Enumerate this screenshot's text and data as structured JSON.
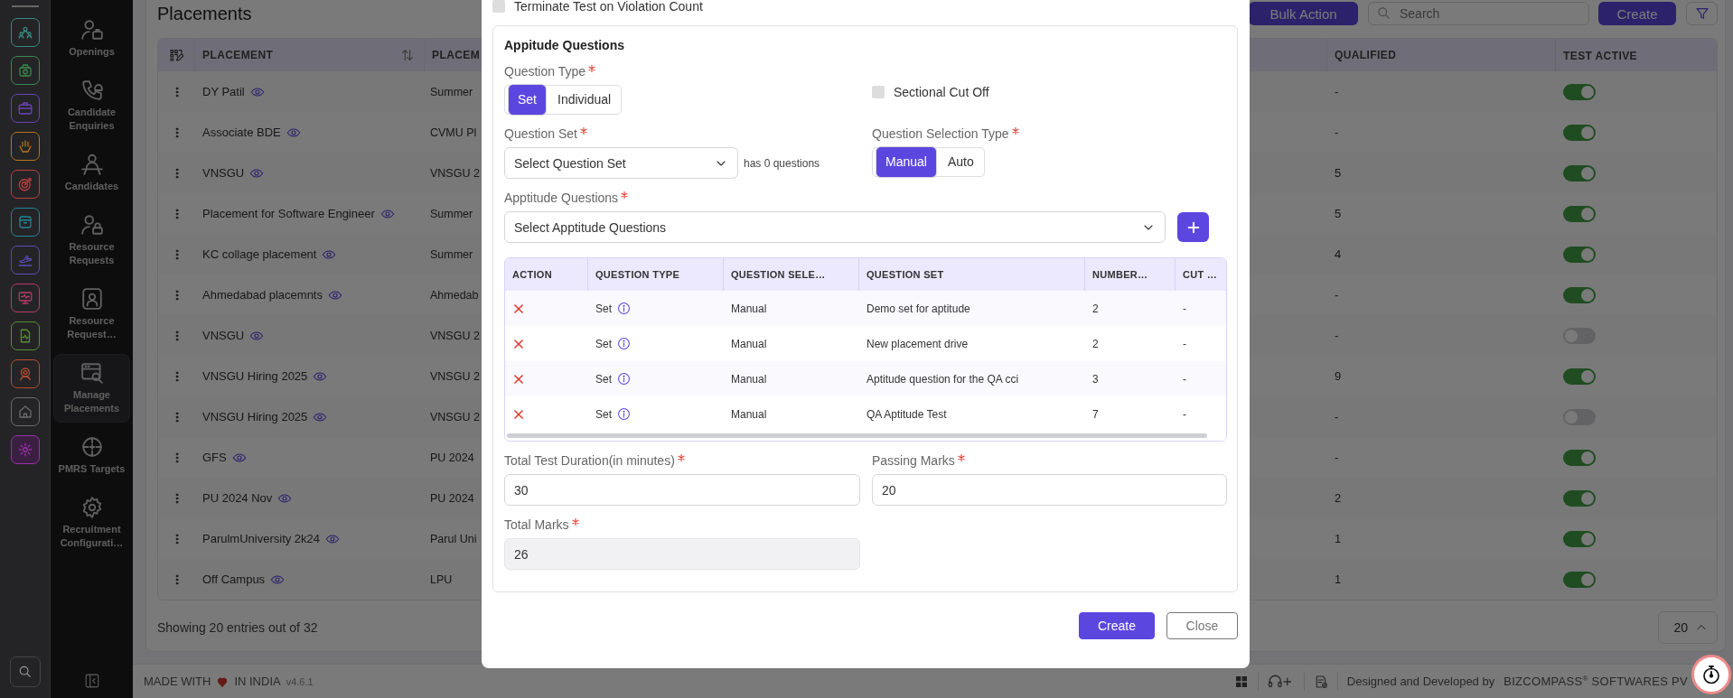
{
  "rail": {
    "apps": [
      {
        "color": "#358a82",
        "selected": false
      },
      {
        "color": "#3a8a4f",
        "selected": false
      },
      {
        "color": "#6a44b8",
        "selected": false
      },
      {
        "color": "#b87518",
        "selected": false
      },
      {
        "color": "#b84040",
        "selected": false
      },
      {
        "color": "#24849a",
        "selected": false
      },
      {
        "color": "#5a4cb8",
        "selected": false
      },
      {
        "color": "#b63b68",
        "selected": false
      },
      {
        "color": "#5a8d32",
        "selected": false
      },
      {
        "color": "#b64c32",
        "selected": false
      },
      {
        "color": "#6b6b6b",
        "selected": false
      },
      {
        "color": "#9932a6",
        "selected": true
      }
    ]
  },
  "nav": {
    "items": [
      {
        "label": "Openings",
        "selected": false
      },
      {
        "label": "Candidate Enquiries",
        "selected": false
      },
      {
        "label": "Candidates",
        "selected": false
      },
      {
        "label": "Resource Requests",
        "selected": false
      },
      {
        "label": "Resource Request…",
        "selected": false
      },
      {
        "label": "Manage Placements",
        "selected": true
      },
      {
        "label": "PMRS Targets",
        "selected": false
      },
      {
        "label": "Recruitment Configurati…",
        "selected": false
      }
    ]
  },
  "page": {
    "title": "Placements",
    "bulk_action": "Bulk Action",
    "search": {
      "placeholder": "Search"
    },
    "create": "Create"
  },
  "table": {
    "columns": [
      "PLACEMENT",
      "PLACEM",
      "QUALIFIED",
      "TEST ACTIVE"
    ],
    "rows": [
      {
        "placement": "DY Patil",
        "column_3": "Summer",
        "qualified": "-",
        "test_active": true
      },
      {
        "placement": "Associate BDE",
        "column_3": "CVMU Pl",
        "qualified": "-",
        "test_active": true
      },
      {
        "placement": "VNSGU",
        "column_3": "VNSGU 2",
        "qualified": "5",
        "test_active": true
      },
      {
        "placement": "Placement for Software Engineer",
        "column_3": "Summer",
        "qualified": "5",
        "test_active": true
      },
      {
        "placement": "KC collage placement",
        "column_3": "Summer",
        "qualified": "4",
        "test_active": true
      },
      {
        "placement": "Ahmedabad placemnts",
        "column_3": "Ahmedab",
        "qualified": "-",
        "test_active": true
      },
      {
        "placement": "VNSGU",
        "column_3": "VNSGU 2",
        "qualified": "-",
        "test_active": false
      },
      {
        "placement": "VNSGU Hiring 2025",
        "column_3": "VNSGU 2",
        "qualified": "9",
        "test_active": true
      },
      {
        "placement": "VNSGU Hiring 2025",
        "column_3": "VNSGU 2",
        "qualified": "-",
        "test_active": false
      },
      {
        "placement": "GFS",
        "column_3": "PU 2024",
        "qualified": "-",
        "test_active": true
      },
      {
        "placement": "PU 2024 Nov",
        "column_3": "PU 2024",
        "qualified": "2",
        "test_active": true
      },
      {
        "placement": "ParulmUniversity 2k24",
        "column_3": "Parul Uni",
        "qualified": "1",
        "test_active": true
      },
      {
        "placement": "Off Campus",
        "column_3": "LPU",
        "qualified": "1",
        "test_active": true
      }
    ]
  },
  "pagination": {
    "summary": "Showing 20 entries out of 32",
    "page_size": "20"
  },
  "footer": {
    "made_with": "MADE WITH",
    "in_india": "IN INDIA",
    "version": "v4.6.1",
    "credit": "Designed and Developed by",
    "company": "BIZCOMPASS$^{®}$ SOFTWARES PV"
  },
  "modal": {
    "terminate_on_violation": {
      "label": "Terminate Test on Violation Count",
      "checked": false
    },
    "section_title": "Appitude Questions",
    "question_type": {
      "label": "Question Type",
      "required": true,
      "options": [
        {
          "label": "Set",
          "selected": true
        },
        {
          "label": "Individual",
          "selected": false
        }
      ]
    },
    "sectional_cut_off": {
      "label": "Sectional Cut Off",
      "checked": false
    },
    "question_set": {
      "label": "Question Set",
      "required": true,
      "placeholder": "Select Question Set",
      "hint": "has 0 questions"
    },
    "question_selection_type": {
      "label": "Question Selection Type",
      "required": true,
      "options": [
        {
          "label": "Manual",
          "selected": true
        },
        {
          "label": "Auto",
          "selected": false
        }
      ]
    },
    "aptitude_questions": {
      "label": "Apptitude Questions",
      "required": true,
      "placeholder": "Select Apptitude Questions"
    },
    "questions_table": {
      "columns": [
        "ACTION",
        "QUESTION TYPE",
        "QUESTION SELE…",
        "QUESTION SET",
        "NUMBER…",
        "CUT …"
      ],
      "rows": [
        {
          "question_type": "Set",
          "selection": "Manual",
          "question_set": "Demo set for aptitude",
          "number": "2",
          "cut_off": "-"
        },
        {
          "question_type": "Set",
          "selection": "Manual",
          "question_set": "New placement drive",
          "number": "2",
          "cut_off": "-"
        },
        {
          "question_type": "Set",
          "selection": "Manual",
          "question_set": "Aptitude question for the QA cci",
          "number": "3",
          "cut_off": "-"
        },
        {
          "question_type": "Set",
          "selection": "Manual",
          "question_set": "QA Aptitude Test",
          "number": "7",
          "cut_off": "-"
        }
      ]
    },
    "total_duration": {
      "label": "Total Test Duration(in minutes)",
      "required": true,
      "value": "30",
      "disabled": false
    },
    "passing_marks": {
      "label": "Passing Marks",
      "required": true,
      "value": "20",
      "disabled": false
    },
    "total_marks": {
      "label": "Total Marks",
      "required": true,
      "value": "26",
      "disabled": true
    },
    "buttons": [
      {
        "label": "Create",
        "kind": "primary"
      },
      {
        "label": "Close",
        "kind": "secondary"
      }
    ]
  }
}
